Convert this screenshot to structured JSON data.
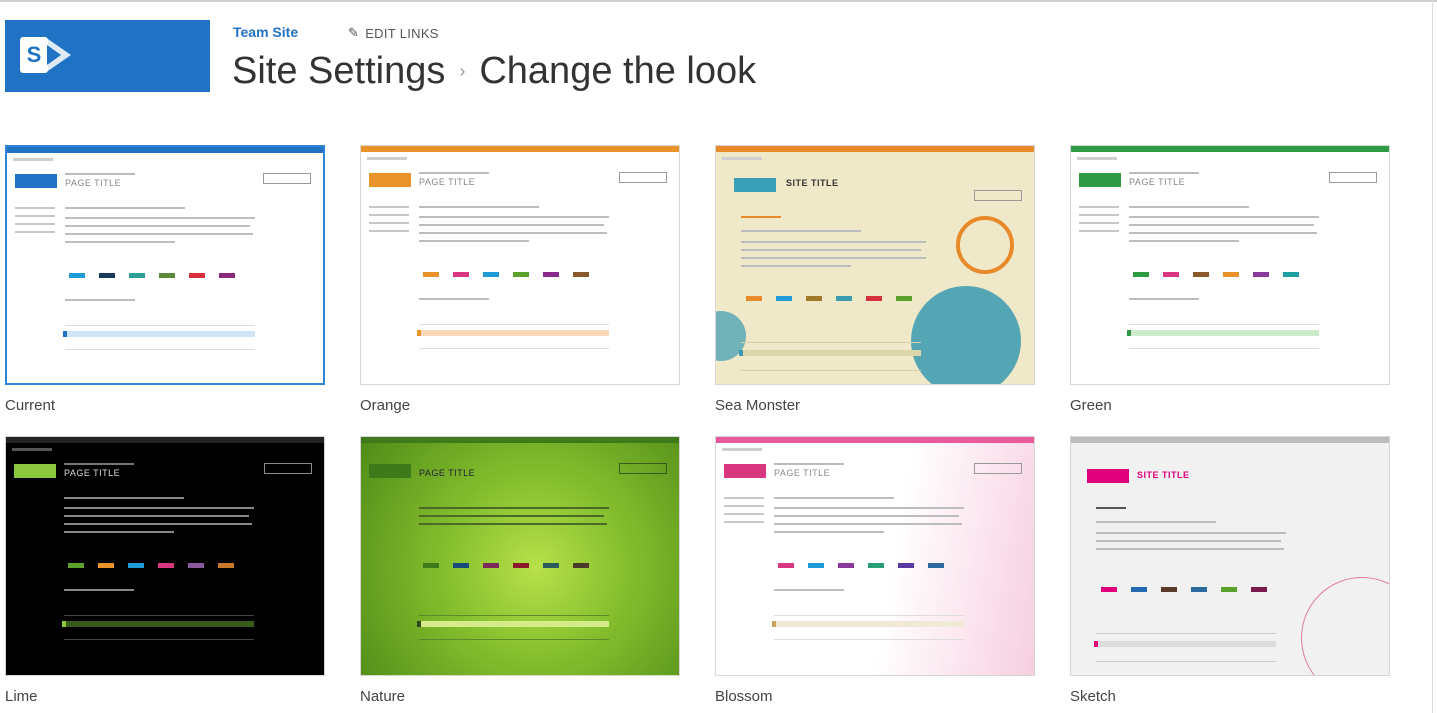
{
  "header": {
    "site_link": "Team Site",
    "edit_links": "EDIT LINKS",
    "breadcrumb_parent": "Site Settings",
    "breadcrumb_separator": "›",
    "page_title": "Change the look"
  },
  "looks": [
    {
      "label": "Current",
      "selected": true,
      "theme_bg": "#ffffff",
      "theme_bar": "#1f72c4",
      "accent": "#1f72c4"
    },
    {
      "label": "Orange",
      "selected": false,
      "theme_bg": "#ffffff",
      "theme_bar": "#e8942a",
      "accent": "#e8942a"
    },
    {
      "label": "Sea Monster",
      "selected": false,
      "theme_bg": "#f0ebcf",
      "theme_bar": "#e88a2a",
      "accent": "#3aa0b7"
    },
    {
      "label": "Green",
      "selected": false,
      "theme_bg": "#ffffff",
      "theme_bar": "#2e9a46",
      "accent": "#2e9a46"
    },
    {
      "label": "Lime",
      "selected": false,
      "theme_bg": "#000000",
      "theme_bar": "#1a1a1a",
      "accent": "#8cc63f"
    },
    {
      "label": "Nature",
      "selected": false,
      "theme_bg": "#7cb82a",
      "theme_bar": "#5a9a1e",
      "accent": "#3f7a1a"
    },
    {
      "label": "Blossom",
      "selected": false,
      "theme_bg": "#ffffff",
      "theme_bar": "#e85a9a",
      "accent": "#d8367f"
    },
    {
      "label": "Sketch",
      "selected": false,
      "theme_bg": "#f0f0f0",
      "theme_bar": "#bcbcbc",
      "accent": "#e2007a"
    }
  ]
}
